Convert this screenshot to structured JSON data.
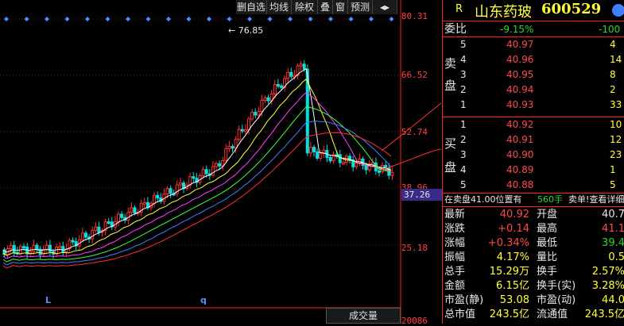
{
  "toolbar": {
    "items": [
      "删自选",
      "均线",
      "除权",
      "叠",
      "窗",
      "预测",
      "◂▸"
    ],
    "indicator_tab": "成交量"
  },
  "stock": {
    "r_label": "R",
    "name": "山东药玻",
    "code": "600529"
  },
  "chart": {
    "high_label": "76.85",
    "axis_labels": [
      "80.31",
      "66.52",
      "52.74",
      "38.96",
      "25.18",
      "20086"
    ],
    "price_tag": "37.26",
    "markers": [
      "L",
      "q"
    ]
  },
  "order_book": {
    "weibi_label": "委比",
    "weibi_value": "-9.15%",
    "weicha_value": "-100",
    "sell_label": [
      "卖",
      "盘"
    ],
    "buy_label": [
      "买",
      "盘"
    ],
    "sell": [
      {
        "level": "5",
        "price": "40.97",
        "vol": "4"
      },
      {
        "level": "4",
        "price": "40.96",
        "vol": "14"
      },
      {
        "level": "3",
        "price": "40.95",
        "vol": "8"
      },
      {
        "level": "2",
        "price": "40.94",
        "vol": "2"
      },
      {
        "level": "1",
        "price": "40.93",
        "vol": "33"
      }
    ],
    "buy": [
      {
        "level": "1",
        "price": "40.92",
        "vol": "10"
      },
      {
        "level": "2",
        "price": "40.91",
        "vol": "12"
      },
      {
        "level": "3",
        "price": "40.90",
        "vol": "23"
      },
      {
        "level": "4",
        "price": "40.89",
        "vol": "1"
      },
      {
        "level": "5",
        "price": "40.88",
        "vol": "5"
      }
    ]
  },
  "notice": {
    "part1": "在卖盘41.00位置有",
    "vol": "560手",
    "link": "卖单!查看详细"
  },
  "stats": [
    {
      "l1": "最新",
      "v1": "40.92",
      "c1": "red",
      "l2": "开盘",
      "v2": "40.7",
      "c2": "white"
    },
    {
      "l1": "涨跌",
      "v1": "+0.14",
      "c1": "red",
      "l2": "最高",
      "v2": "41.1",
      "c2": "red"
    },
    {
      "l1": "涨幅",
      "v1": "+0.34%",
      "c1": "red",
      "l2": "最低",
      "v2": "39.4",
      "c2": "green"
    },
    {
      "l1": "振幅",
      "v1": "4.17%",
      "c1": "yellow",
      "l2": "量比",
      "v2": "0.5",
      "c2": "yellow"
    },
    {
      "l1": "总手",
      "v1": "15.29万",
      "c1": "yellow",
      "l2": "换手",
      "v2": "2.57%",
      "c2": "yellow"
    },
    {
      "l1": "金额",
      "v1": "6.15亿",
      "c1": "yellow",
      "l2": "换手(实)",
      "v2": "3.28%",
      "c2": "yellow"
    },
    {
      "l1": "市盈(静)",
      "v1": "53.08",
      "c1": "yellow",
      "l2": "市盈(动)",
      "v2": "44.0",
      "c2": "yellow"
    },
    {
      "l1": "总市值",
      "v1": "243.5亿",
      "c1": "yellow",
      "l2": "流通值",
      "v2": "243.5亿",
      "c2": "yellow"
    }
  ],
  "colors": {
    "up": "#ff3030",
    "down": "#00e0e0",
    "accent": "#3a2a8a"
  }
}
